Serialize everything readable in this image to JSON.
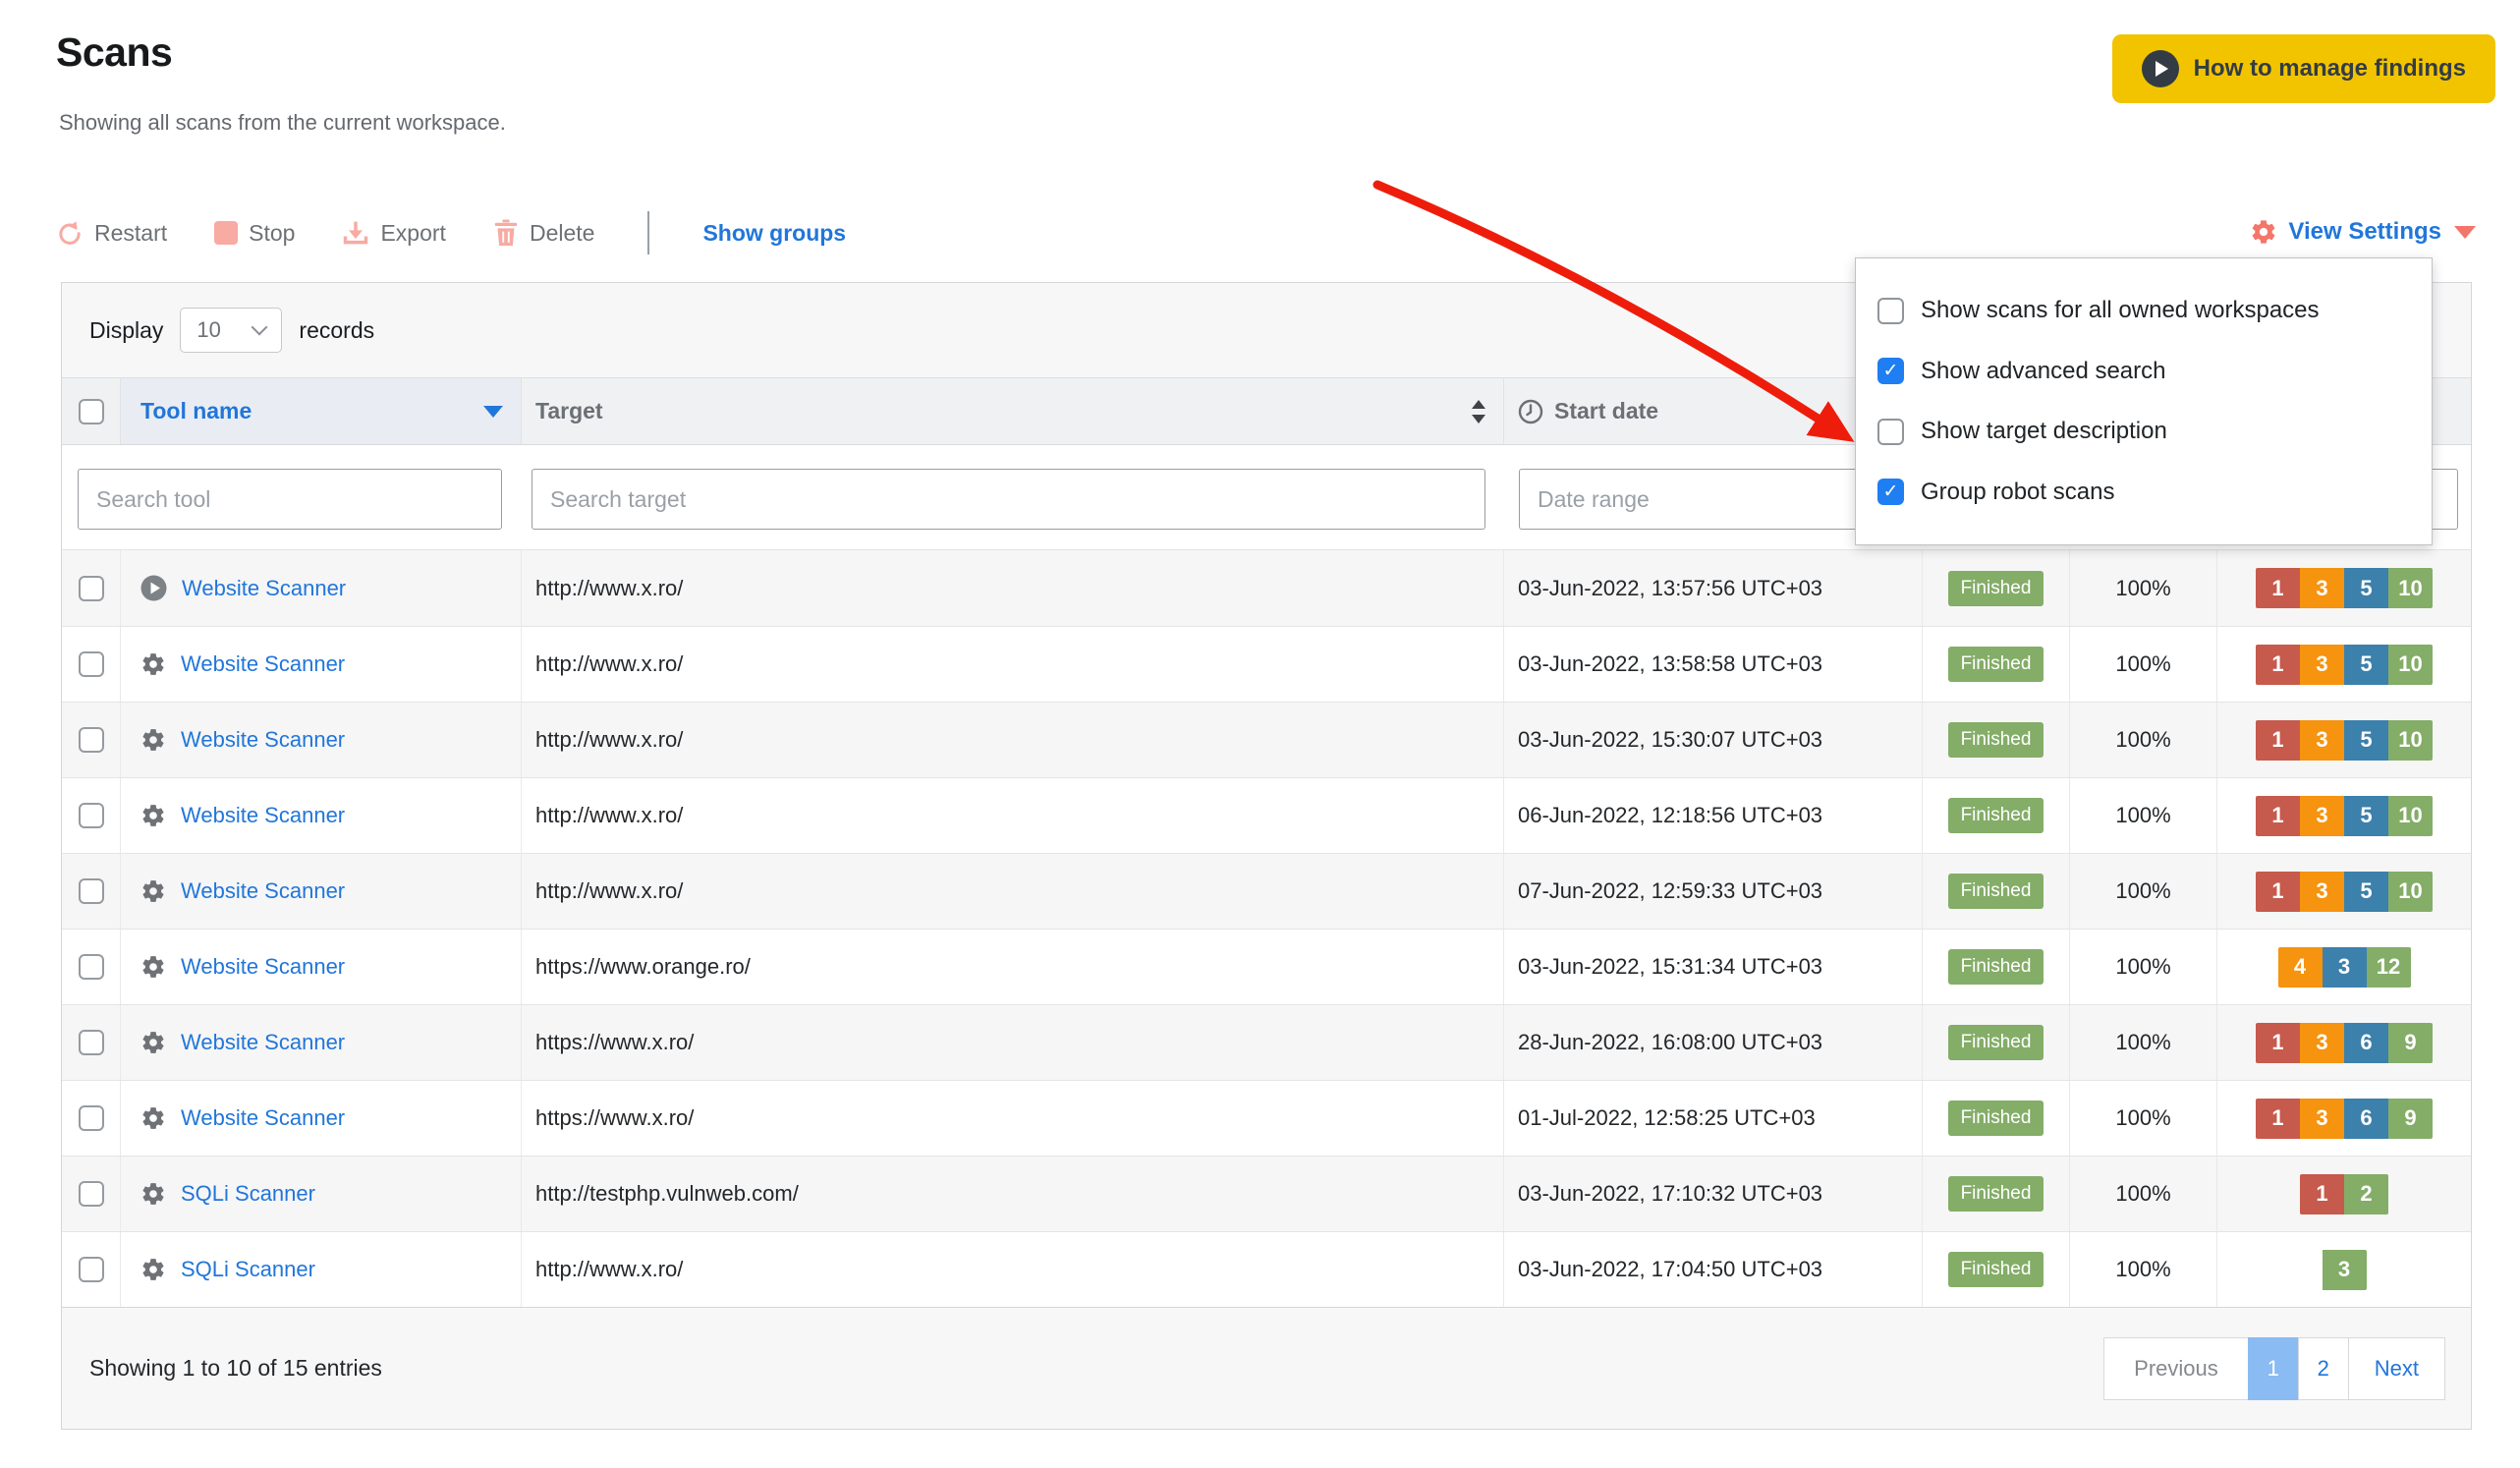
{
  "page": {
    "title": "Scans",
    "subtitle": "Showing all scans from the current workspace."
  },
  "header_button": {
    "label": "How to manage findings"
  },
  "toolbar": {
    "restart": "Restart",
    "stop": "Stop",
    "export": "Export",
    "delete": "Delete",
    "show_groups": "Show groups",
    "view_settings": "View Settings"
  },
  "display_bar": {
    "label_before": "Display",
    "page_size": "10",
    "label_after": "records"
  },
  "view_settings_menu": {
    "items": [
      {
        "label": "Show scans for all owned workspaces",
        "checked": false
      },
      {
        "label": "Show advanced search",
        "checked": true
      },
      {
        "label": "Show target description",
        "checked": false
      },
      {
        "label": "Group robot scans",
        "checked": true
      }
    ]
  },
  "table": {
    "columns": {
      "tool_name": "Tool name",
      "target": "Target",
      "start_date": "Start date"
    },
    "search_placeholders": {
      "tool": "Search tool",
      "target": "Search target",
      "date": "Date range",
      "findings": ""
    },
    "severity_colors": {
      "red": "#c65a4d",
      "orange": "#f6930f",
      "blue": "#3c80ac",
      "green": "#84ad68"
    },
    "rows": [
      {
        "icon": "play-circle",
        "tool": "Website Scanner",
        "target": "http://www.x.ro/",
        "start_date": "03-Jun-2022, 13:57:56 UTC+03",
        "status": "Finished",
        "progress": "100%",
        "findings": [
          {
            "count": "1",
            "severity": "red"
          },
          {
            "count": "3",
            "severity": "orange"
          },
          {
            "count": "5",
            "severity": "blue"
          },
          {
            "count": "10",
            "severity": "green"
          }
        ]
      },
      {
        "icon": "gear",
        "tool": "Website Scanner",
        "target": "http://www.x.ro/",
        "start_date": "03-Jun-2022, 13:58:58 UTC+03",
        "status": "Finished",
        "progress": "100%",
        "findings": [
          {
            "count": "1",
            "severity": "red"
          },
          {
            "count": "3",
            "severity": "orange"
          },
          {
            "count": "5",
            "severity": "blue"
          },
          {
            "count": "10",
            "severity": "green"
          }
        ]
      },
      {
        "icon": "gear",
        "tool": "Website Scanner",
        "target": "http://www.x.ro/",
        "start_date": "03-Jun-2022, 15:30:07 UTC+03",
        "status": "Finished",
        "progress": "100%",
        "findings": [
          {
            "count": "1",
            "severity": "red"
          },
          {
            "count": "3",
            "severity": "orange"
          },
          {
            "count": "5",
            "severity": "blue"
          },
          {
            "count": "10",
            "severity": "green"
          }
        ]
      },
      {
        "icon": "gear",
        "tool": "Website Scanner",
        "target": "http://www.x.ro/",
        "start_date": "06-Jun-2022, 12:18:56 UTC+03",
        "status": "Finished",
        "progress": "100%",
        "findings": [
          {
            "count": "1",
            "severity": "red"
          },
          {
            "count": "3",
            "severity": "orange"
          },
          {
            "count": "5",
            "severity": "blue"
          },
          {
            "count": "10",
            "severity": "green"
          }
        ]
      },
      {
        "icon": "gear",
        "tool": "Website Scanner",
        "target": "http://www.x.ro/",
        "start_date": "07-Jun-2022, 12:59:33 UTC+03",
        "status": "Finished",
        "progress": "100%",
        "findings": [
          {
            "count": "1",
            "severity": "red"
          },
          {
            "count": "3",
            "severity": "orange"
          },
          {
            "count": "5",
            "severity": "blue"
          },
          {
            "count": "10",
            "severity": "green"
          }
        ]
      },
      {
        "icon": "gear",
        "tool": "Website Scanner",
        "target": "https://www.orange.ro/",
        "start_date": "03-Jun-2022, 15:31:34 UTC+03",
        "status": "Finished",
        "progress": "100%",
        "findings": [
          {
            "count": "4",
            "severity": "orange"
          },
          {
            "count": "3",
            "severity": "blue"
          },
          {
            "count": "12",
            "severity": "green"
          }
        ]
      },
      {
        "icon": "gear",
        "tool": "Website Scanner",
        "target": "https://www.x.ro/",
        "start_date": "28-Jun-2022, 16:08:00 UTC+03",
        "status": "Finished",
        "progress": "100%",
        "findings": [
          {
            "count": "1",
            "severity": "red"
          },
          {
            "count": "3",
            "severity": "orange"
          },
          {
            "count": "6",
            "severity": "blue"
          },
          {
            "count": "9",
            "severity": "green"
          }
        ]
      },
      {
        "icon": "gear",
        "tool": "Website Scanner",
        "target": "https://www.x.ro/",
        "start_date": "01-Jul-2022, 12:58:25 UTC+03",
        "status": "Finished",
        "progress": "100%",
        "findings": [
          {
            "count": "1",
            "severity": "red"
          },
          {
            "count": "3",
            "severity": "orange"
          },
          {
            "count": "6",
            "severity": "blue"
          },
          {
            "count": "9",
            "severity": "green"
          }
        ]
      },
      {
        "icon": "gear",
        "tool": "SQLi Scanner",
        "target": "http://testphp.vulnweb.com/",
        "start_date": "03-Jun-2022, 17:10:32 UTC+03",
        "status": "Finished",
        "progress": "100%",
        "findings": [
          {
            "count": "1",
            "severity": "red"
          },
          {
            "count": "2",
            "severity": "green"
          }
        ]
      },
      {
        "icon": "gear",
        "tool": "SQLi Scanner",
        "target": "http://www.x.ro/",
        "start_date": "03-Jun-2022, 17:04:50 UTC+03",
        "status": "Finished",
        "progress": "100%",
        "findings": [
          {
            "count": "3",
            "severity": "green"
          }
        ]
      }
    ]
  },
  "footer": {
    "summary": "Showing 1 to 10 of 15 entries",
    "pagination": {
      "previous": "Previous",
      "pages": [
        "1",
        "2"
      ],
      "active_page": "1",
      "next": "Next"
    }
  },
  "colors": {
    "accent_yellow": "#f2c400",
    "link_blue": "#2176d9",
    "salmon": "#f4766a",
    "salmon_light": "#f7aba2",
    "badge_green": "#84ad68",
    "arrow_red": "#ee1d0b",
    "pagination_active_bg": "#8abbf2",
    "checkbox_checked_blue": "#1f7ef2"
  }
}
